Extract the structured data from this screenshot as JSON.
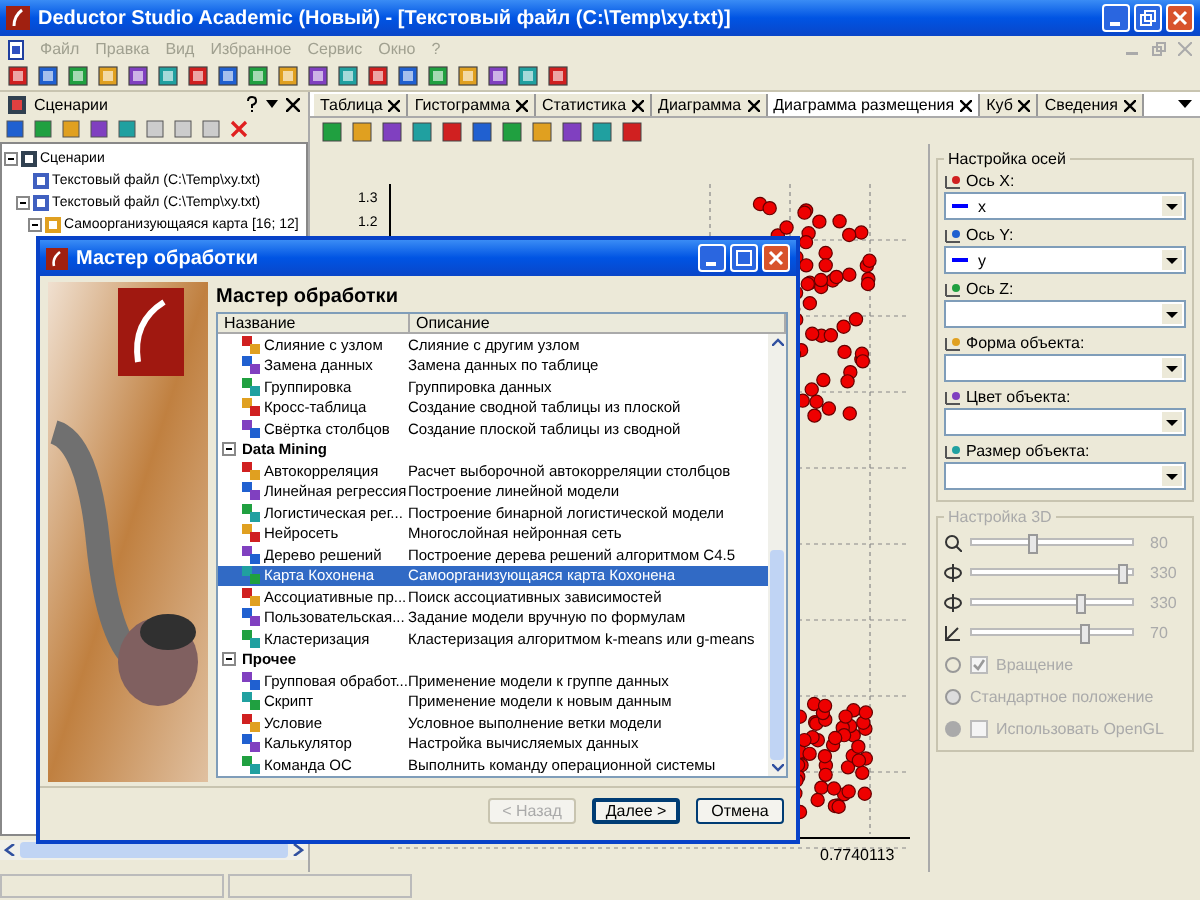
{
  "window": {
    "title": "Deductor Studio Academic (Новый) - [Текстовый файл (C:\\Temp\\xy.txt)]"
  },
  "menu": [
    {
      "label": "Файл",
      "disabled": true
    },
    {
      "label": "Правка",
      "disabled": true
    },
    {
      "label": "Вид",
      "disabled": true
    },
    {
      "label": "Избранное",
      "disabled": true
    },
    {
      "label": "Сервис",
      "disabled": true
    },
    {
      "label": "Окно",
      "disabled": true
    },
    {
      "label": "?",
      "disabled": true
    }
  ],
  "scenarios_panel": {
    "title": "Сценарии",
    "tree": [
      {
        "label": "Сценарии",
        "expanded": true,
        "children": [
          {
            "label": "Текстовый файл (C:\\Temp\\xy.txt)"
          },
          {
            "label": "Текстовый файл (C:\\Temp\\xy.txt)",
            "expanded": true,
            "children": [
              {
                "label": "Самоорганизующаяся карта [16; 12]",
                "expanded": true
              }
            ]
          }
        ]
      }
    ]
  },
  "tabs": [
    {
      "label": "Таблица",
      "selected": false
    },
    {
      "label": "Гистограмма",
      "selected": false
    },
    {
      "label": "Статистика",
      "selected": false
    },
    {
      "label": "Диаграмма",
      "selected": false
    },
    {
      "label": "Диаграмма размещения",
      "selected": true
    },
    {
      "label": "Куб",
      "selected": false
    },
    {
      "label": "Сведения",
      "selected": false
    }
  ],
  "chart": {
    "y_ticks": [
      "1.3",
      "1.2"
    ],
    "x_tick": "0.7740113"
  },
  "axes_settings": {
    "title": "Настройка осей",
    "fields": [
      {
        "label": "Ось X:",
        "value": "x"
      },
      {
        "label": "Ось Y:",
        "value": "y"
      },
      {
        "label": "Ось Z:"
      },
      {
        "label": "Форма объекта:"
      },
      {
        "label": "Цвет объекта:"
      },
      {
        "label": "Размер объекта:"
      }
    ]
  },
  "settings_3d": {
    "title": "Настройка 3D",
    "disabled": true,
    "sliders": [
      {
        "level": 0.38,
        "reading": "80"
      },
      {
        "level": 0.93,
        "reading": "330"
      },
      {
        "level": 0.67,
        "reading": "330"
      },
      {
        "level": 0.69,
        "reading": "70"
      }
    ],
    "rotation": {
      "label": "Вращение",
      "checked": true
    },
    "reset_button": "Стандартное положение",
    "opengl": {
      "label": "Использовать OpenGL",
      "checked": false
    }
  },
  "dialog": {
    "title": "Мастер обработки",
    "heading": "Мастер обработки",
    "columns": [
      "Название",
      "Описание"
    ],
    "rows": [
      {
        "kind": "item",
        "name": "Слияние с узлом",
        "description": "Слияние с другим узлом",
        "selected": false
      },
      {
        "kind": "item",
        "name": "Замена данных",
        "description": "Замена данных по таблице",
        "selected": false
      },
      {
        "kind": "item",
        "name": "Группировка",
        "description": "Группировка данных",
        "selected": false
      },
      {
        "kind": "item",
        "name": "Кросс-таблица",
        "description": "Создание сводной таблицы из плоской",
        "selected": false
      },
      {
        "kind": "item",
        "name": "Свёртка столбцов",
        "description": "Создание плоской таблицы из сводной",
        "selected": false
      },
      {
        "kind": "group",
        "name": "Data Mining",
        "expanded": true
      },
      {
        "kind": "item",
        "name": "Автокорреляция",
        "description": "Расчет выборочной автокорреляции столбцов",
        "selected": false
      },
      {
        "kind": "item",
        "name": "Линейная регрессия",
        "description": "Построение линейной модели",
        "selected": false
      },
      {
        "kind": "item",
        "name": "Логистическая рег...",
        "description": "Построение бинарной логистической модели",
        "selected": false
      },
      {
        "kind": "item",
        "name": "Нейросеть",
        "description": "Многослойная нейронная сеть",
        "selected": false
      },
      {
        "kind": "item",
        "name": "Дерево решений",
        "description": "Построение дерева решений алгоритмом C4.5",
        "selected": false
      },
      {
        "kind": "item",
        "name": "Карта Кохонена",
        "description": "Самоорганизующаяся карта Кохонена",
        "selected": true
      },
      {
        "kind": "item",
        "name": "Ассоциативные пр...",
        "description": "Поиск ассоциативных зависимостей",
        "selected": false
      },
      {
        "kind": "item",
        "name": "Пользовательская...",
        "description": "Задание модели вручную по формулам",
        "selected": false
      },
      {
        "kind": "item",
        "name": "Кластеризация",
        "description": "Кластеризация алгоритмом k-means или g-means",
        "selected": false
      },
      {
        "kind": "group",
        "name": "Прочее",
        "expanded": true
      },
      {
        "kind": "item",
        "name": "Групповая обработ...",
        "description": "Применение модели к группе данных",
        "selected": false
      },
      {
        "kind": "item",
        "name": "Скрипт",
        "description": "Применение модели к новым данным",
        "selected": false
      },
      {
        "kind": "item",
        "name": "Условие",
        "description": "Условное выполнение ветки модели",
        "selected": false
      },
      {
        "kind": "item",
        "name": "Калькулятор",
        "description": "Настройка вычисляемых данных",
        "selected": false
      },
      {
        "kind": "item",
        "name": "Команда ОС",
        "description": "Выполнить команду операционной системы",
        "selected": false
      }
    ],
    "buttons": [
      {
        "label": "< Назад",
        "disabled": true,
        "default": false
      },
      {
        "label": "Далее >",
        "disabled": false,
        "default": true
      },
      {
        "label": "Отмена",
        "disabled": false,
        "default": false
      }
    ]
  }
}
